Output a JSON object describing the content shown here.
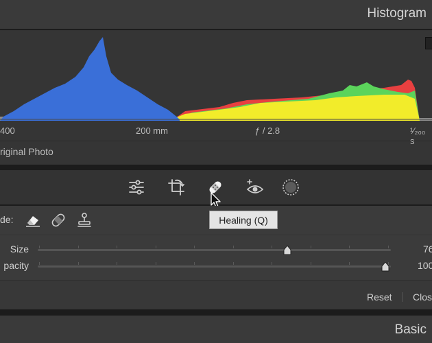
{
  "histogram": {
    "title": "Histogram",
    "info": {
      "iso": "400",
      "focal_length": "200 mm",
      "aperture": "ƒ / 2.8",
      "shutter": "¹⁄₂₀₀ s"
    },
    "origin": "riginal Photo"
  },
  "tools": [
    {
      "name": "edit-sliders-icon"
    },
    {
      "name": "crop-icon"
    },
    {
      "name": "healing-icon",
      "active": true
    },
    {
      "name": "red-eye-icon"
    },
    {
      "name": "masking-icon"
    }
  ],
  "tooltip": "Healing (Q)",
  "panel": {
    "mode_label": "de:",
    "mode_tools": [
      "content-aware-remove-icon",
      "heal-icon",
      "clone-stamp-icon"
    ],
    "size": {
      "label": "Size",
      "value": "76",
      "fraction": 0.76
    },
    "opacity": {
      "label": "pacity",
      "value": "100",
      "fraction": 1.0
    },
    "reset": "Reset",
    "close": "Clos"
  },
  "basic": {
    "title": "Basic"
  },
  "colors": {
    "accent_blue": "#3a6fd8",
    "yellow": "#f2ec2a",
    "green": "#5bd45b",
    "red": "#e84040"
  }
}
